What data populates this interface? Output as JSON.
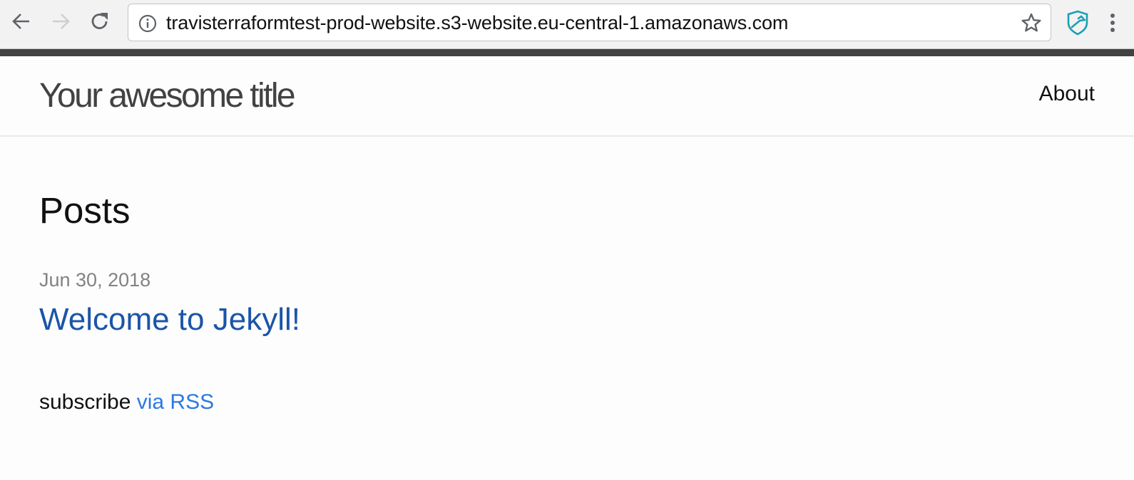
{
  "browser": {
    "url": "travisterraformtest-prod-website.s3-website.eu-central-1.amazonaws.com",
    "icons": {
      "back": "arrow-left-icon",
      "forward": "arrow-right-icon",
      "reload": "reload-icon",
      "info": "info-circle-icon",
      "bookmark": "star-icon",
      "extension": "shield-extension-icon",
      "menu": "kebab-menu-icon"
    },
    "colors": {
      "extension_accent": "#1a9fb5",
      "stripe": "#424242"
    }
  },
  "site": {
    "title": "Your awesome title",
    "nav": [
      {
        "label": "About"
      }
    ]
  },
  "main": {
    "heading": "Posts",
    "posts": [
      {
        "date": "Jun 30, 2018",
        "title": "Welcome to Jekyll!"
      }
    ],
    "rss": {
      "prefix": "subscribe",
      "link_label": "via RSS"
    }
  },
  "colors": {
    "link": "#1a55a8",
    "rss_link": "#2a7ae2",
    "meta": "#828282",
    "title": "#424242"
  }
}
